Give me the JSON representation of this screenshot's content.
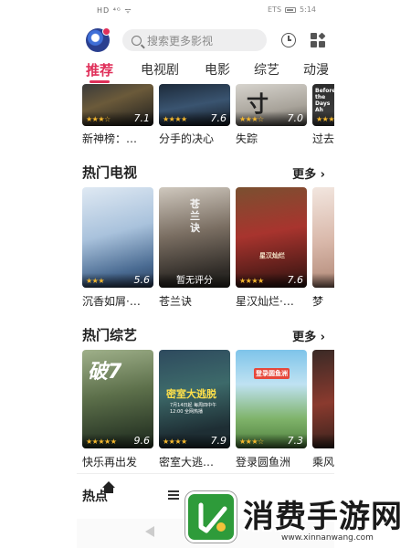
{
  "status_bar": {
    "left": "HD ⁴ᴳ ᯤ",
    "right_carrier": "ETS",
    "time": "5:14"
  },
  "header": {
    "search_placeholder": "搜索更多影视",
    "logo_icon": "app-logo-icon",
    "history_icon": "history-icon",
    "apps_icon": "apps-grid-icon"
  },
  "tabs": [
    {
      "label": "推荐",
      "active": true
    },
    {
      "label": "电视剧",
      "active": false
    },
    {
      "label": "电影",
      "active": false
    },
    {
      "label": "综艺",
      "active": false
    },
    {
      "label": "动漫",
      "active": false
    }
  ],
  "top_row": {
    "items": [
      {
        "title": "新神榜：…",
        "stars": "★★★☆",
        "score": "7.1"
      },
      {
        "title": "分手的决心",
        "stars": "★★★★",
        "score": "7.6"
      },
      {
        "title": "失踪",
        "stars": "★★★☆",
        "score": "7.0",
        "poster_text": "寸"
      },
      {
        "title": "过去",
        "stars": "★★★",
        "score": "",
        "poster_text": "Before the Days Ah"
      }
    ]
  },
  "tv_section": {
    "title": "热门电视",
    "more": "更多",
    "items": [
      {
        "title": "沉香如屑·…",
        "stars": "★★★",
        "score": "5.6"
      },
      {
        "title": "苍兰诀",
        "stars": "",
        "score": "",
        "no_score": "暂无评分",
        "poster_text": "苍兰诀"
      },
      {
        "title": "星汉灿烂·…",
        "stars": "★★★★",
        "score": "7.6",
        "poster_text": "星汉灿烂"
      },
      {
        "title": "梦",
        "stars": "",
        "score": ""
      }
    ]
  },
  "variety_section": {
    "title": "热门综艺",
    "more": "更多",
    "items": [
      {
        "title": "快乐再出发",
        "stars": "★★★★★",
        "score": "9.6",
        "poster_text": "破7"
      },
      {
        "title": "密室大逃…",
        "stars": "★★★★",
        "score": "7.9",
        "poster_text": "密室大逃脱",
        "poster_sub": "7月14日起 每周四中午12:00 全网热播"
      },
      {
        "title": "登录圆鱼洲",
        "stars": "★★★☆",
        "score": "7.3",
        "poster_text": "登录圆鱼洲"
      },
      {
        "title": "乘风",
        "stars": "",
        "score": ""
      }
    ]
  },
  "bottom_nav": {
    "items": [
      {
        "label": "热点",
        "icon": "home-icon"
      },
      {
        "label": "",
        "icon": "list-icon"
      }
    ]
  },
  "watermark": {
    "text": "消费手游网",
    "url": "www.xinnanwang.com",
    "logo_icon": "controller-logo-icon"
  }
}
